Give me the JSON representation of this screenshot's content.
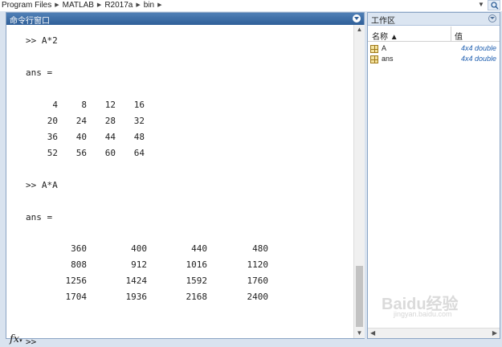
{
  "breadcrumb": [
    "Program Files",
    "MATLAB",
    "R2017a",
    "bin"
  ],
  "command_window": {
    "title": "命令行窗口",
    "cmd1": ">> A*2",
    "ans1": "ans =",
    "matrix1": [
      [
        "4",
        "8",
        "12",
        "16"
      ],
      [
        "20",
        "24",
        "28",
        "32"
      ],
      [
        "36",
        "40",
        "44",
        "48"
      ],
      [
        "52",
        "56",
        "60",
        "64"
      ]
    ],
    "cmd2": ">> A*A",
    "ans2": "ans =",
    "matrix2": [
      [
        "360",
        "400",
        "440",
        "480"
      ],
      [
        "808",
        "912",
        "1016",
        "1120"
      ],
      [
        "1256",
        "1424",
        "1592",
        "1760"
      ],
      [
        "1704",
        "1936",
        "2168",
        "2400"
      ]
    ],
    "prompt": ">>",
    "fx_icon": "fx"
  },
  "workspace": {
    "title": "工作区",
    "col_name": "名称 ▲",
    "col_value": "值",
    "vars": [
      {
        "name": "A",
        "value": "4x4 double"
      },
      {
        "name": "ans",
        "value": "4x4 double"
      }
    ]
  },
  "watermark": "Baidu经验",
  "watermark_sub": "jingyan.baidu.com",
  "icons": [
    "dropdown-icon",
    "search-icon",
    "collapse-icon",
    "fx-icon",
    "variable-icon"
  ]
}
